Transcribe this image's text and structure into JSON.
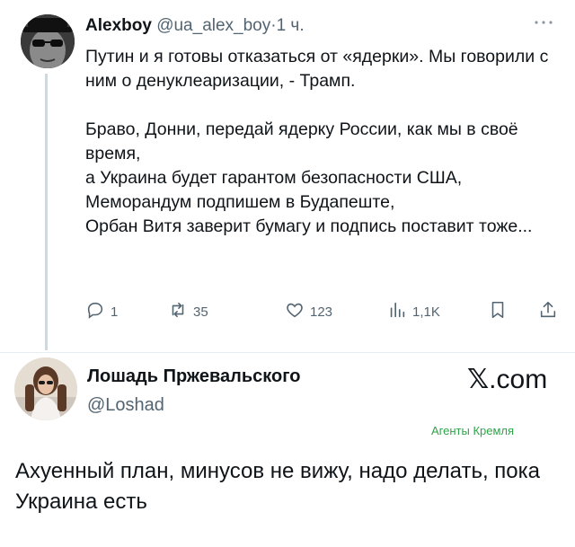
{
  "tweet": {
    "author_name": "Alexboy",
    "handle": "@ua_alex_boy",
    "separator": "·",
    "time": "1 ч.",
    "paragraphs": [
      "Путин и я готовы отказаться от «ядерки». Мы говорили с ним о денуклеаризации, - Трамп.",
      "Браво, Донни, передай ядерку России, как мы в своё время,\nа Украина будет гарантом безопасности США,\nМеморандум подпишем в Будапеште,\nОрбан Витя заверит бумагу и подпись поставит тоже..."
    ],
    "actions": {
      "replies": "1",
      "retweets": "35",
      "likes": "123",
      "views": "1,1K"
    },
    "icons": [
      "more-icon",
      "reply-icon",
      "retweet-icon",
      "like-icon",
      "views-icon",
      "bookmark-icon",
      "share-icon"
    ]
  },
  "repost": {
    "name": "Лошадь Пржевальского",
    "handle": "@Loshad",
    "site_x": "𝕏",
    "site_rest": ".com",
    "watermark": "Агенты Кремля",
    "caption": "Ахуенный план, минусов не вижу, надо делать, пока Украина есть"
  },
  "colors": {
    "text": "#0f1419",
    "secondary": "#536471",
    "watermark": "#2fa34a",
    "thread_line": "#cfd9de"
  }
}
